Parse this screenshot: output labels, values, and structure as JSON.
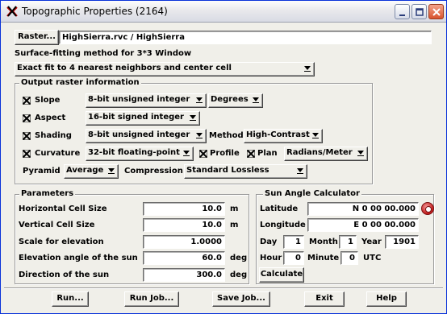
{
  "window": {
    "title": "Topographic Properties (2164)"
  },
  "raster": {
    "button_label": "Raster...",
    "value": "HighSierra.rvc / HighSierra"
  },
  "surface": {
    "label": "Surface-fitting method for 3*3 Window",
    "method": "Exact fit to 4 nearest neighbors and center cell"
  },
  "output": {
    "title": "Output raster information",
    "slope": {
      "label": "Slope",
      "checked": true,
      "type": "8-bit unsigned integer",
      "units": "Degrees"
    },
    "aspect": {
      "label": "Aspect",
      "checked": true,
      "type": "16-bit signed integer"
    },
    "shading": {
      "label": "Shading",
      "checked": true,
      "type": "8-bit unsigned integer",
      "method_label": "Method",
      "method": "High-Contrast"
    },
    "curvature": {
      "label": "Curvature",
      "checked": true,
      "type": "32-bit floating-point",
      "profile_label": "Profile",
      "profile_checked": true,
      "plan_label": "Plan",
      "plan_checked": true,
      "units": "Radians/Meter"
    },
    "pyramid_label": "Pyramid",
    "pyramid": "Average",
    "compression_label": "Compression",
    "compression": "Standard Lossless"
  },
  "parameters": {
    "title": "Parameters",
    "horizontal_cell": {
      "label": "Horizontal Cell Size",
      "value": "10.0",
      "unit": "m"
    },
    "vertical_cell": {
      "label": "Vertical Cell Size",
      "value": "10.0",
      "unit": "m"
    },
    "scale": {
      "label": "Scale for elevation",
      "value": "1.0000"
    },
    "elevation_angle": {
      "label": "Elevation angle of the sun",
      "value": "60.0",
      "unit": "deg"
    },
    "direction": {
      "label": "Direction of the sun",
      "value": "300.0",
      "unit": "deg"
    }
  },
  "sun": {
    "title": "Sun Angle Calculator",
    "latitude_label": "Latitude",
    "latitude": "N 0 00 00.000",
    "longitude_label": "Longitude",
    "longitude": "E 0 00 00.000",
    "day_label": "Day",
    "day": "1",
    "month_label": "Month",
    "month": "1",
    "year_label": "Year",
    "year": "1901",
    "hour_label": "Hour",
    "hour": "0",
    "minute_label": "Minute",
    "minute": "0",
    "utc_label": "UTC",
    "calculate_label": "Calculate"
  },
  "buttons": {
    "run": "Run...",
    "run_job": "Run Job...",
    "save_job": "Save Job...",
    "exit": "Exit",
    "help": "Help"
  }
}
